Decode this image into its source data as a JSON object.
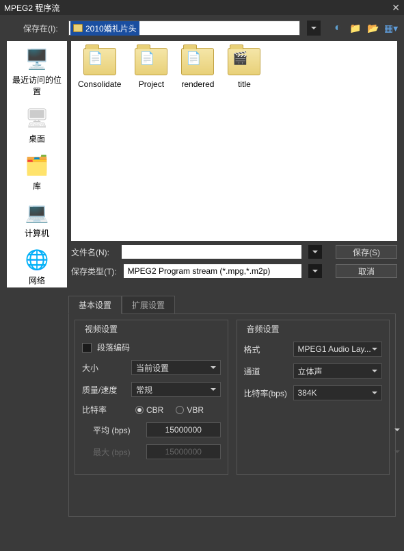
{
  "titlebar": {
    "title": "MPEG2 程序流"
  },
  "saveRow": {
    "label": "保存在(I):",
    "value": "2010婚礼片头"
  },
  "places": [
    {
      "label": "最近访问的位置"
    },
    {
      "label": "桌面"
    },
    {
      "label": "库"
    },
    {
      "label": "计算机"
    },
    {
      "label": "网络"
    }
  ],
  "folders": [
    {
      "label": "Consolidate"
    },
    {
      "label": "Project"
    },
    {
      "label": "rendered"
    },
    {
      "label": "title"
    }
  ],
  "fields": {
    "filenameLabel": "文件名(N):",
    "filenameValue": "",
    "typeLabel": "保存类型(T):",
    "typeValue": "MPEG2 Program stream (*.mpg,*.m2p)",
    "saveBtn": "保存(S)",
    "cancelBtn": "取消"
  },
  "tabs": {
    "basic": "基本设置",
    "extended": "扩展设置"
  },
  "video": {
    "groupTitle": "视频设置",
    "segment": "段落编码",
    "sizeLabel": "大小",
    "sizeValue": "当前设置",
    "qualityLabel": "质量/速度",
    "qualityValue": "常规",
    "bitrateLabel": "比特率",
    "cbr": "CBR",
    "vbr": "VBR",
    "avgLabel": "平均 (bps)",
    "avgValue": "15000000",
    "maxLabel": "最大 (bps)",
    "maxValue": "15000000"
  },
  "audio": {
    "groupTitle": "音频设置",
    "formatLabel": "格式",
    "formatValue": "MPEG1 Audio Lay...",
    "channelLabel": "通道",
    "channelValue": "立体声",
    "bitrateLabel": "比特率(bps)",
    "bitrateValue": "384K"
  }
}
